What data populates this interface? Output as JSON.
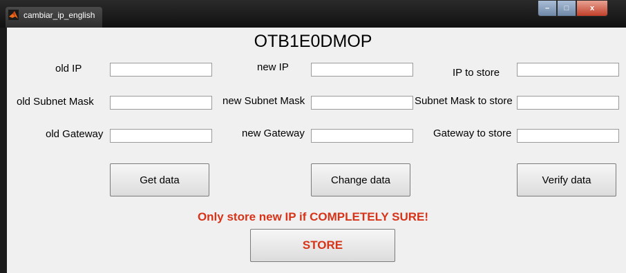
{
  "window": {
    "title": "cambiar_ip_english",
    "controls": {
      "minimize": "–",
      "maximize": "□",
      "close": "x"
    }
  },
  "heading": "OTB1E0DMOP",
  "columns": {
    "old": {
      "ip_label": "old IP",
      "subnet_label": "old Subnet Mask",
      "gateway_label": "old Gateway",
      "ip_value": "",
      "subnet_value": "",
      "gateway_value": ""
    },
    "new": {
      "ip_label": "new IP",
      "subnet_label": "new Subnet Mask",
      "gateway_label": "new Gateway",
      "ip_value": "",
      "subnet_value": "",
      "gateway_value": ""
    },
    "store": {
      "ip_label": "IP to store",
      "subnet_label": "Subnet Mask to store",
      "gateway_label": "Gateway to store",
      "ip_value": "",
      "subnet_value": "",
      "gateway_value": ""
    }
  },
  "buttons": {
    "get_data": "Get data",
    "change_data": "Change data",
    "verify_data": "Verify data",
    "store": "STORE"
  },
  "warning": "Only store new IP if COMPLETELY  SURE!",
  "colors": {
    "warning": "#d63318",
    "background": "#f0f0f0"
  }
}
